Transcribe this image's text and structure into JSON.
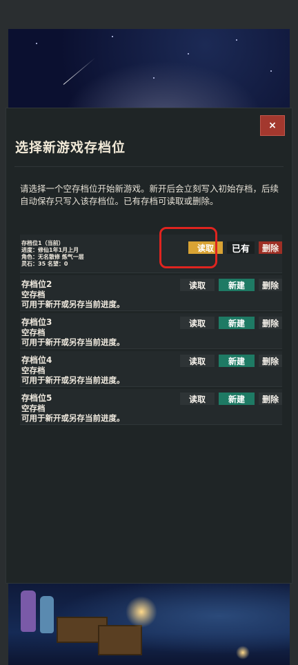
{
  "dialog": {
    "close_label": "×",
    "title": "选择新游戏存档位",
    "description": "请选择一个空存档位开始新游戏。新开后会立刻写入初始存档，后续自动保存只写入该存档位。已有存档可读取或删除。"
  },
  "slots": [
    {
      "name": "存档位1（当前）",
      "progress": "进度：修仙1年1月上月",
      "character": "角色：无名散修    炼气一层",
      "stats": "灵石：35    名望：0",
      "read_label": "读取",
      "status_label": "已有",
      "delete_label": "删除"
    },
    {
      "name": "存档位2",
      "status": "空存档",
      "hint": "可用于新开或另存当前进度。",
      "read_label": "读取",
      "new_label": "新建",
      "delete_label": "删除"
    },
    {
      "name": "存档位3",
      "status": "空存档",
      "hint": "可用于新开或另存当前进度。",
      "read_label": "读取",
      "new_label": "新建",
      "delete_label": "删除"
    },
    {
      "name": "存档位4",
      "status": "空存档",
      "hint": "可用于新开或另存当前进度。",
      "read_label": "读取",
      "new_label": "新建",
      "delete_label": "删除"
    },
    {
      "name": "存档位5",
      "status": "空存档",
      "hint": "可用于新开或另存当前进度。",
      "read_label": "读取",
      "new_label": "新建",
      "delete_label": "删除"
    }
  ],
  "colors": {
    "read_highlight": "#d9a334",
    "new_button": "#1e7a64",
    "delete_active": "#9e2f25",
    "close_button": "#a3382e",
    "annotation_ring": "#e0241f"
  }
}
